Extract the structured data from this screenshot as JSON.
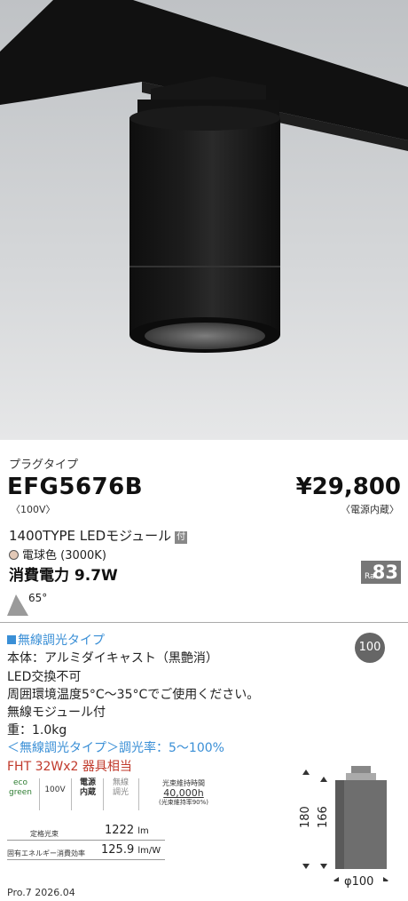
{
  "product": {
    "type_label": "プラグタイプ",
    "model": "EFG5676B",
    "voltage": "〈100V〉",
    "price": "¥29,800",
    "price_note": "〈電源内蔵〉"
  },
  "spec_header": {
    "module": "1400TYPE LEDモジュール",
    "module_badge": "付",
    "color_name": "電球色",
    "color_temp": "(3000K)",
    "power": "消費電力 9.7W",
    "ra_label": "Ra",
    "ra_value": "83",
    "beam_angle": "65°"
  },
  "wireless": {
    "title": "無線調光タイプ",
    "badge": "100"
  },
  "specs": {
    "body": "本体：アルミダイキャスト（黒艶消）",
    "led": "LED交換不可",
    "temp": "周囲環境温度5°C～35°Cでご使用ください。",
    "module": "無線モジュール付",
    "weight": "重：1.0kg",
    "dimming": "＜無線調光タイプ＞調光率：5～100%",
    "equiv": "FHT 32Wx2 器具相当"
  },
  "icons": {
    "eco_top": "eco",
    "eco_bottom": "green",
    "v100": "100V",
    "power_in_top": "電源",
    "power_in_bottom": "内蔵",
    "wireless_top": "無線",
    "wireless_bottom": "調光",
    "life_title": "光束維持時間",
    "life_value": "40,000h",
    "life_note": "(光束維持率90%)"
  },
  "efficiency": {
    "flux_label": "定格光束",
    "flux_value": "1222",
    "flux_unit": "lm",
    "eff_label": "固有エネルギー消費効率",
    "eff_value": "125.9",
    "eff_unit": "lm/W"
  },
  "dimensions": {
    "h1": "180",
    "h2": "166",
    "diameter": "φ100"
  },
  "footer": "Pro.7 2026.04"
}
